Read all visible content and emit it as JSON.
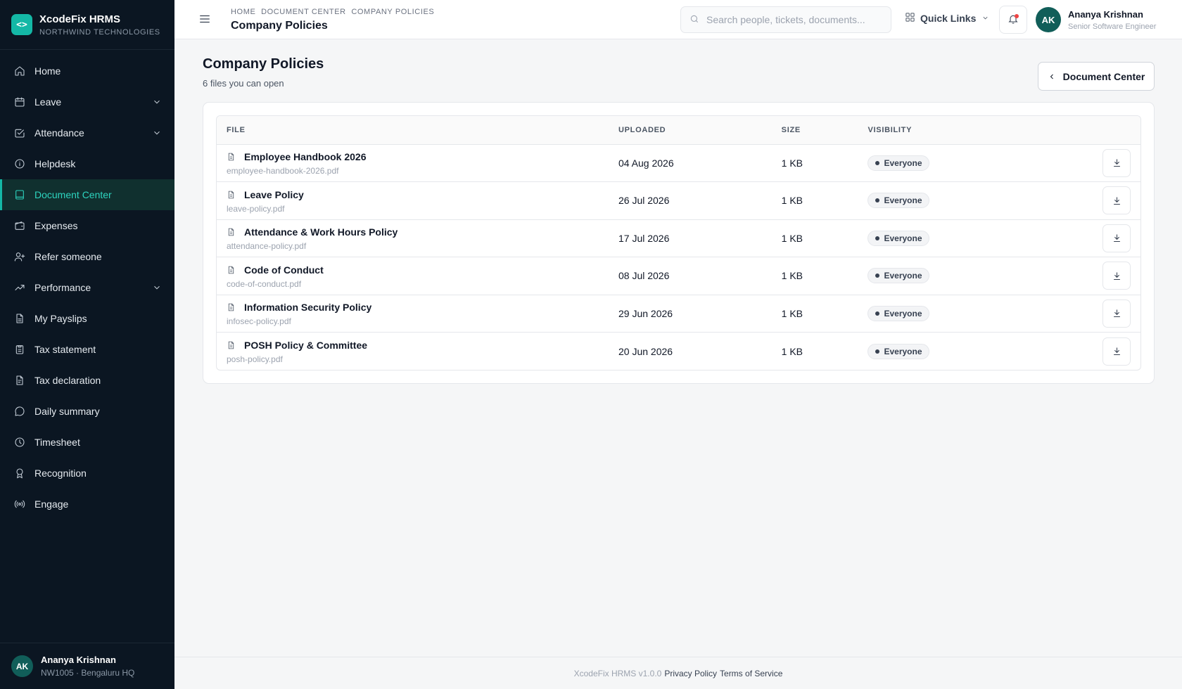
{
  "brand": {
    "name": "XcodeFix HRMS",
    "org": "NORTHWIND TECHNOLOGIES",
    "logo_glyph": "<>"
  },
  "sidebar": {
    "items": [
      {
        "label": "Home",
        "icon": "home-icon"
      },
      {
        "label": "Leave",
        "icon": "calendar-icon",
        "expandable": true
      },
      {
        "label": "Attendance",
        "icon": "calendar-check-icon",
        "expandable": true
      },
      {
        "label": "Helpdesk",
        "icon": "info-icon"
      },
      {
        "label": "Document Center",
        "icon": "book-icon",
        "active": true
      },
      {
        "label": "Expenses",
        "icon": "wallet-icon"
      },
      {
        "label": "Refer someone",
        "icon": "user-plus-icon"
      },
      {
        "label": "Performance",
        "icon": "trending-up-icon",
        "expandable": true
      },
      {
        "label": "My Payslips",
        "icon": "file-icon"
      },
      {
        "label": "Tax statement",
        "icon": "clipboard-icon"
      },
      {
        "label": "Tax declaration",
        "icon": "file-text-icon"
      },
      {
        "label": "Daily summary",
        "icon": "message-circle-icon"
      },
      {
        "label": "Timesheet",
        "icon": "clock-icon"
      },
      {
        "label": "Recognition",
        "icon": "award-icon"
      },
      {
        "label": "Engage",
        "icon": "radio-icon"
      }
    ],
    "user": {
      "initials": "AK",
      "name": "Ananya Krishnan",
      "meta": "NW1005 · Bengaluru HQ"
    }
  },
  "topbar": {
    "breadcrumb": [
      "HOME",
      "DOCUMENT CENTER",
      "COMPANY POLICIES"
    ],
    "title": "Company Policies",
    "search_placeholder": "Search people, tickets, documents...",
    "quick_links_label": "Quick Links",
    "user": {
      "initials": "AK",
      "name": "Ananya Krishnan",
      "role": "Senior Software Engineer"
    }
  },
  "main": {
    "title": "Company Policies",
    "subtitle": "6 files you can open",
    "back_label": "Document Center",
    "table": {
      "headers": {
        "file": "FILE",
        "uploaded": "UPLOADED",
        "size": "SIZE",
        "visibility": "VISIBILITY"
      },
      "rows": [
        {
          "name": "Employee Handbook 2026",
          "file": "employee-handbook-2026.pdf",
          "uploaded": "04 Aug 2026",
          "size": "1 KB",
          "visibility": "Everyone"
        },
        {
          "name": "Leave Policy",
          "file": "leave-policy.pdf",
          "uploaded": "26 Jul 2026",
          "size": "1 KB",
          "visibility": "Everyone"
        },
        {
          "name": "Attendance & Work Hours Policy",
          "file": "attendance-policy.pdf",
          "uploaded": "17 Jul 2026",
          "size": "1 KB",
          "visibility": "Everyone"
        },
        {
          "name": "Code of Conduct",
          "file": "code-of-conduct.pdf",
          "uploaded": "08 Jul 2026",
          "size": "1 KB",
          "visibility": "Everyone"
        },
        {
          "name": "Information Security Policy",
          "file": "infosec-policy.pdf",
          "uploaded": "29 Jun 2026",
          "size": "1 KB",
          "visibility": "Everyone"
        },
        {
          "name": "POSH Policy & Committee",
          "file": "posh-policy.pdf",
          "uploaded": "20 Jun 2026",
          "size": "1 KB",
          "visibility": "Everyone"
        }
      ]
    }
  },
  "footer": {
    "version": "XcodeFix HRMS v1.0.0",
    "privacy": "Privacy Policy",
    "terms": "Terms of Service"
  },
  "colors": {
    "accent": "#14b8a6",
    "sidebar_bg": "#0b1622",
    "active_bg": "#10302f",
    "notification_dot": "#ef4444"
  }
}
